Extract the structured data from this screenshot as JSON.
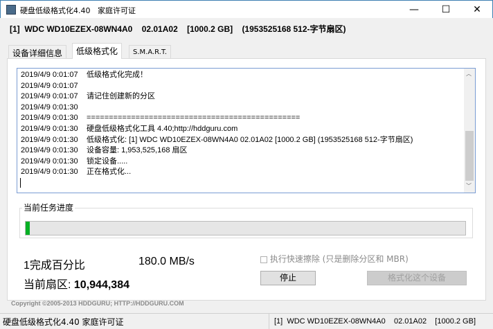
{
  "window": {
    "title": "硬盘低级格式化4.40",
    "license": "家庭许可证",
    "minimize": "—",
    "maximize": "☐",
    "close": "✕"
  },
  "device_line": "[1]  WDC WD10EZEX-08WN4A0    02.01A02    [1000.2 GB]    (1953525168 512-字节扇区)",
  "tabs": [
    {
      "label": "设备详细信息"
    },
    {
      "label": "低级格式化"
    },
    {
      "label": "S.M.A.R.T."
    }
  ],
  "log": [
    {
      "t": "2019/4/9 0:01:07",
      "m": "低级格式化完成！"
    },
    {
      "t": "2019/4/9 0:01:07",
      "m": ""
    },
    {
      "t": "2019/4/9 0:01:07",
      "m": "请记住创建新的分区"
    },
    {
      "t": "2019/4/9 0:01:30",
      "m": ""
    },
    {
      "t": "2019/4/9 0:01:30",
      "m": "================================================"
    },
    {
      "t": "2019/4/9 0:01:30",
      "m": "硬盘低级格式化工具 4.40;http://hddguru.com"
    },
    {
      "t": "2019/4/9 0:01:30",
      "m": "低级格式化: [1]  WDC WD10EZEX-08WN4A0    02.01A02    [1000.2 GB]    (1953525168 512-字节扇区)"
    },
    {
      "t": "2019/4/9 0:01:30",
      "m": "设备容量: 1,953,525,168 扇区"
    },
    {
      "t": "2019/4/9 0:01:30",
      "m": "锁定设备....."
    },
    {
      "t": "2019/4/9 0:01:30",
      "m": "正在格式化..."
    }
  ],
  "progress": {
    "label": "当前任务进度",
    "percent": 1
  },
  "stats": {
    "percent_text": "1完成百分比",
    "speed": "180.0 MB/s",
    "sector_label": "当前扇区:",
    "sector_value": "10,944,384"
  },
  "quick_wipe": {
    "label": "执行快速擦除 (只是删除分区和 MBR)",
    "checked": false
  },
  "buttons": {
    "stop": "停止",
    "format": "格式化这个设备"
  },
  "copyright": "Copyright ©2005-2013 HDDGURU;  HTTP://HDDGURU.COM",
  "statusbar": {
    "left": "硬盘低级格式化4.40  家庭许可证",
    "right": "[1]  WDC WD10EZEX-08WN4A0    02.01A02    [1000.2 GB]"
  },
  "colors": {
    "progress": "#06b025",
    "accent": "#3c7fb1"
  }
}
